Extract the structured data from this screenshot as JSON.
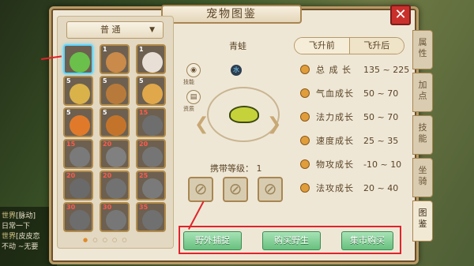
{
  "window": {
    "title": "宠物图鉴",
    "close_label": "✕"
  },
  "dropdown": {
    "label": "普 通",
    "arrow": "▼"
  },
  "chat": {
    "lines": [
      {
        "tag": "世界",
        "text": "[脉动]"
      },
      {
        "tag": "",
        "text": "日常一下"
      },
      {
        "tag": "世界",
        "text": "[皮皮恋"
      },
      {
        "tag": "",
        "text": "不动 ~无要"
      }
    ]
  },
  "pets": [
    {
      "level": "",
      "color": "#6ac04a",
      "selected": true
    },
    {
      "level": "1",
      "color": "#c98a4a"
    },
    {
      "level": "1",
      "color": "#e8e0d6"
    },
    {
      "level": "5",
      "color": "#d9b24a"
    },
    {
      "level": "5",
      "color": "#b87a3a"
    },
    {
      "level": "5",
      "color": "#e0a84a"
    },
    {
      "level": "5",
      "color": "#e07a2a"
    },
    {
      "level": "5",
      "color": "#c4742a"
    },
    {
      "level": "15",
      "color": "#6e6e6e",
      "red": true
    },
    {
      "level": "15",
      "color": "#7a7a7a",
      "red": true
    },
    {
      "level": "20",
      "color": "#808080",
      "red": true
    },
    {
      "level": "20",
      "color": "#757575",
      "red": true
    },
    {
      "level": "20",
      "color": "#6a6a6a",
      "red": true
    },
    {
      "level": "20",
      "color": "#727272",
      "red": true
    },
    {
      "level": "25",
      "color": "#7a7a7a",
      "red": true
    },
    {
      "level": "30",
      "color": "#6d6d6d",
      "red": true
    },
    {
      "level": "30",
      "color": "#777777",
      "red": true
    },
    {
      "level": "35",
      "color": "#707070",
      "red": true
    }
  ],
  "pager": {
    "dots": "● ○ ○ ○ ○"
  },
  "detail": {
    "pet_name": "青蛙",
    "carry_label": "携带等级：",
    "carry_level": "1",
    "side_icons": [
      {
        "glyph": "◉",
        "label": "技能"
      },
      {
        "glyph": "▤",
        "label": "资质"
      }
    ],
    "water_glyph": "水"
  },
  "tabs": {
    "before": "飞升前",
    "after": "飞升后"
  },
  "stats": [
    {
      "name": "总 成 长",
      "min": "135",
      "max": "225"
    },
    {
      "name": "气血成长",
      "min": "50",
      "max": "70"
    },
    {
      "name": "法力成长",
      "min": "50",
      "max": "70"
    },
    {
      "name": "速度成长",
      "min": "25",
      "max": "35"
    },
    {
      "name": "物攻成长",
      "min": "-10",
      "max": "10"
    },
    {
      "name": "法攻成长",
      "min": "20",
      "max": "40"
    }
  ],
  "side_tabs": [
    "属性",
    "加点",
    "技能",
    "坐骑",
    "图鉴"
  ],
  "buttons": {
    "wild_capture": "野外捕捉",
    "buy_wild": "购买野生",
    "market_buy": "集市购买"
  }
}
